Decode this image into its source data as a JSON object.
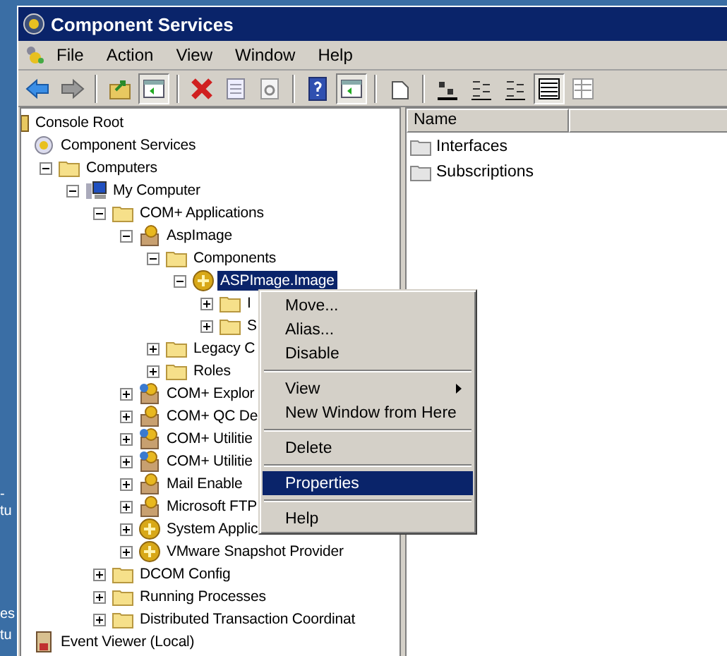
{
  "desktop_labels": [
    "-",
    "tu",
    "es",
    "tu"
  ],
  "window": {
    "title": "Component Services"
  },
  "menu_bar": [
    "File",
    "Action",
    "View",
    "Window",
    "Help"
  ],
  "toolbar": [
    {
      "kind": "back",
      "pressed": false
    },
    {
      "kind": "forward",
      "pressed": false
    },
    {
      "kind": "sep"
    },
    {
      "kind": "up",
      "pressed": false
    },
    {
      "kind": "tree",
      "pressed": true
    },
    {
      "kind": "sep"
    },
    {
      "kind": "delete",
      "pressed": false
    },
    {
      "kind": "properties",
      "pressed": false
    },
    {
      "kind": "refresh",
      "pressed": false
    },
    {
      "kind": "sep"
    },
    {
      "kind": "help",
      "pressed": false
    },
    {
      "kind": "pane",
      "pressed": true
    },
    {
      "kind": "sep"
    },
    {
      "kind": "export",
      "pressed": false
    },
    {
      "kind": "sep"
    },
    {
      "kind": "large",
      "pressed": false
    },
    {
      "kind": "small",
      "pressed": false
    },
    {
      "kind": "list",
      "pressed": false
    },
    {
      "kind": "detail",
      "pressed": true
    },
    {
      "kind": "custom",
      "pressed": false
    }
  ],
  "tree": [
    {
      "label": "Console Root",
      "kind": "root",
      "children": [
        {
          "label": "Component Services",
          "kind": "services",
          "children": [
            {
              "label": "Computers",
              "kind": "folder",
              "expanded": true,
              "selected": false,
              "children": [
                {
                  "label": "My Computer",
                  "kind": "computer",
                  "expanded": true,
                  "selected": false,
                  "children": [
                    {
                      "label": "COM+ Applications",
                      "kind": "folder",
                      "expanded": true,
                      "selected": false,
                      "children": [
                        {
                          "label": "AspImage",
                          "kind": "package",
                          "expanded": true,
                          "selected": false,
                          "children": [
                            {
                              "label": "Components",
                              "kind": "folder",
                              "expanded": true,
                              "selected": false,
                              "children": [
                                {
                                  "label": "ASPImage.Image",
                                  "kind": "component",
                                  "expanded": true,
                                  "selected": true,
                                  "children": [
                                    {
                                      "label": "I",
                                      "kind": "folder",
                                      "expanded": false,
                                      "selected": false
                                    },
                                    {
                                      "label": "S",
                                      "kind": "folder",
                                      "expanded": false,
                                      "selected": false
                                    }
                                  ]
                                }
                              ]
                            },
                            {
                              "label": "Legacy C",
                              "kind": "folder",
                              "expanded": false,
                              "selected": false
                            },
                            {
                              "label": "Roles",
                              "kind": "folder",
                              "expanded": false,
                              "selected": false
                            }
                          ]
                        },
                        {
                          "label": "COM+ Explor",
                          "kind": "package2",
                          "expanded": false,
                          "selected": false
                        },
                        {
                          "label": "COM+ QC De",
                          "kind": "package",
                          "expanded": false,
                          "selected": false
                        },
                        {
                          "label": "COM+ Utilitie",
                          "kind": "package2",
                          "expanded": false,
                          "selected": false
                        },
                        {
                          "label": "COM+ Utilitie",
                          "kind": "package2",
                          "expanded": false,
                          "selected": false
                        },
                        {
                          "label": "Mail Enable",
                          "kind": "package",
                          "expanded": false,
                          "selected": false
                        },
                        {
                          "label": "Microsoft FTP",
                          "kind": "package",
                          "expanded": false,
                          "selected": false
                        },
                        {
                          "label": "System Applic",
                          "kind": "component",
                          "expanded": false,
                          "selected": false
                        },
                        {
                          "label": "VMware Snapshot Provider",
                          "kind": "component",
                          "expanded": false,
                          "selected": false
                        }
                      ]
                    },
                    {
                      "label": "DCOM Config",
                      "kind": "folder",
                      "expanded": false,
                      "selected": false
                    },
                    {
                      "label": "Running Processes",
                      "kind": "folder",
                      "expanded": false,
                      "selected": false
                    },
                    {
                      "label": "Distributed Transaction Coordinat",
                      "kind": "folder",
                      "expanded": false,
                      "selected": false
                    }
                  ]
                }
              ]
            }
          ]
        },
        {
          "label": "Event Viewer (Local)",
          "kind": "event"
        }
      ]
    }
  ],
  "list": {
    "columns": [
      "Name"
    ],
    "items": [
      "Interfaces",
      "Subscriptions"
    ]
  },
  "context_menu": [
    {
      "kind": "item",
      "label": "Move...",
      "selected": false
    },
    {
      "kind": "item",
      "label": "Alias...",
      "selected": false
    },
    {
      "kind": "item",
      "label": "Disable",
      "selected": false
    },
    {
      "kind": "separator"
    },
    {
      "kind": "submenu",
      "label": "View",
      "selected": false
    },
    {
      "kind": "item",
      "label": "New Window from Here",
      "selected": false
    },
    {
      "kind": "separator"
    },
    {
      "kind": "item",
      "label": "Delete",
      "selected": false
    },
    {
      "kind": "separator"
    },
    {
      "kind": "item",
      "label": "Properties",
      "selected": true
    },
    {
      "kind": "separator"
    },
    {
      "kind": "item",
      "label": "Help",
      "selected": false
    }
  ]
}
